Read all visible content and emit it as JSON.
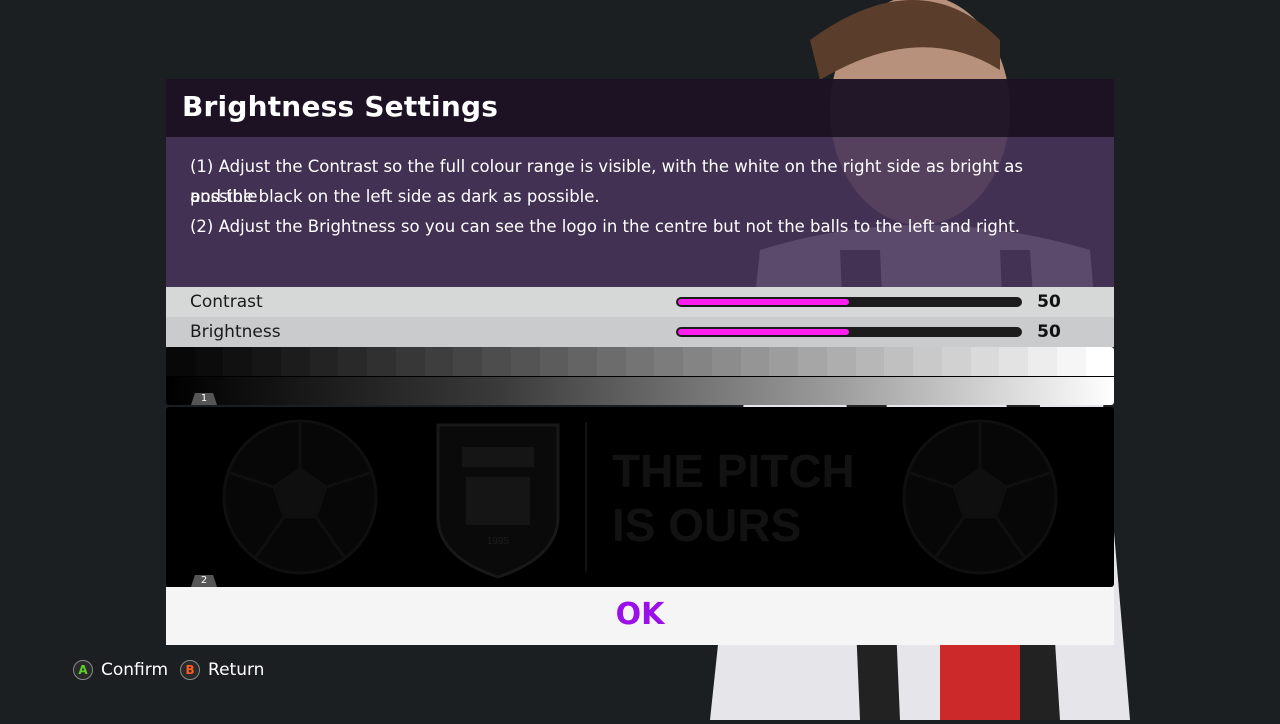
{
  "title": "Brightness Settings",
  "instructions": {
    "line1": "(1) Adjust the Contrast so the full colour range is visible, with the white on the right side as bright as possible",
    "line2": "and the black on the left side as dark as possible.",
    "line3": "(2) Adjust the Brightness so you can see the logo in the centre but not the balls to the left and right."
  },
  "sliders": {
    "contrast": {
      "label": "Contrast",
      "value": "50",
      "fraction": 0.5
    },
    "brightness": {
      "label": "Brightness",
      "value": "50",
      "fraction": 0.5
    }
  },
  "test_panels": {
    "ramp_tag": "1",
    "logo_tag": "2",
    "logo_year": "1995",
    "slogan_line1": "THE PITCH",
    "slogan_line2": "IS OURS"
  },
  "ok_label": "OK",
  "footer": {
    "confirm_key": "A",
    "confirm_label": "Confirm",
    "return_key": "B",
    "return_label": "Return"
  },
  "colors": {
    "accent": "#9b0fe8",
    "slider_fill": "#ff1ef0",
    "confirm_key": "#5bd12a",
    "return_key": "#ff5a1f"
  }
}
